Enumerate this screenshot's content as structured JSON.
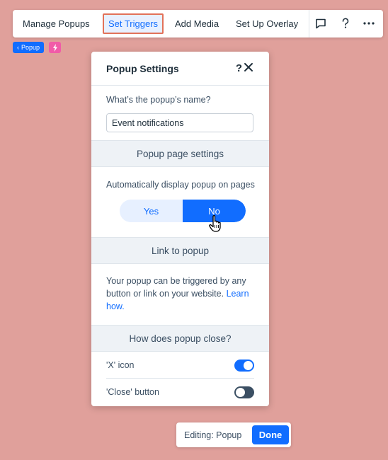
{
  "toolbar": {
    "manage_popups": "Manage Popups",
    "set_triggers": "Set Triggers",
    "add_media": "Add Media",
    "set_up_overlay": "Set Up Overlay",
    "icons": [
      "comment-icon",
      "help-icon",
      "more-icon"
    ]
  },
  "breadcrumb": {
    "popup_tag": "Popup"
  },
  "panel": {
    "title": "Popup Settings",
    "help_glyph": "?",
    "name_question": "What’s the popup’s name?",
    "name_value": "Event notifications",
    "page_settings_header": "Popup page settings",
    "auto_display_label": "Automatically display popup on pages",
    "yes_label": "Yes",
    "no_label": "No",
    "selected": "No",
    "link_header": "Link to popup",
    "link_text": "Your popup can be triggered by any button or link on your website.",
    "learn_how": "Learn how.",
    "close_header": "How does popup close?",
    "x_icon_label": "'X' icon",
    "x_icon_enabled": true,
    "close_button_label": "'Close' button",
    "close_button_enabled": false
  },
  "editing_bar": {
    "label": "Editing: Popup",
    "done": "Done"
  },
  "colors": {
    "background": "#e0a09b",
    "accent": "#116dff",
    "highlight_border": "#e2725a",
    "bolt_tag": "#f15ba8"
  }
}
